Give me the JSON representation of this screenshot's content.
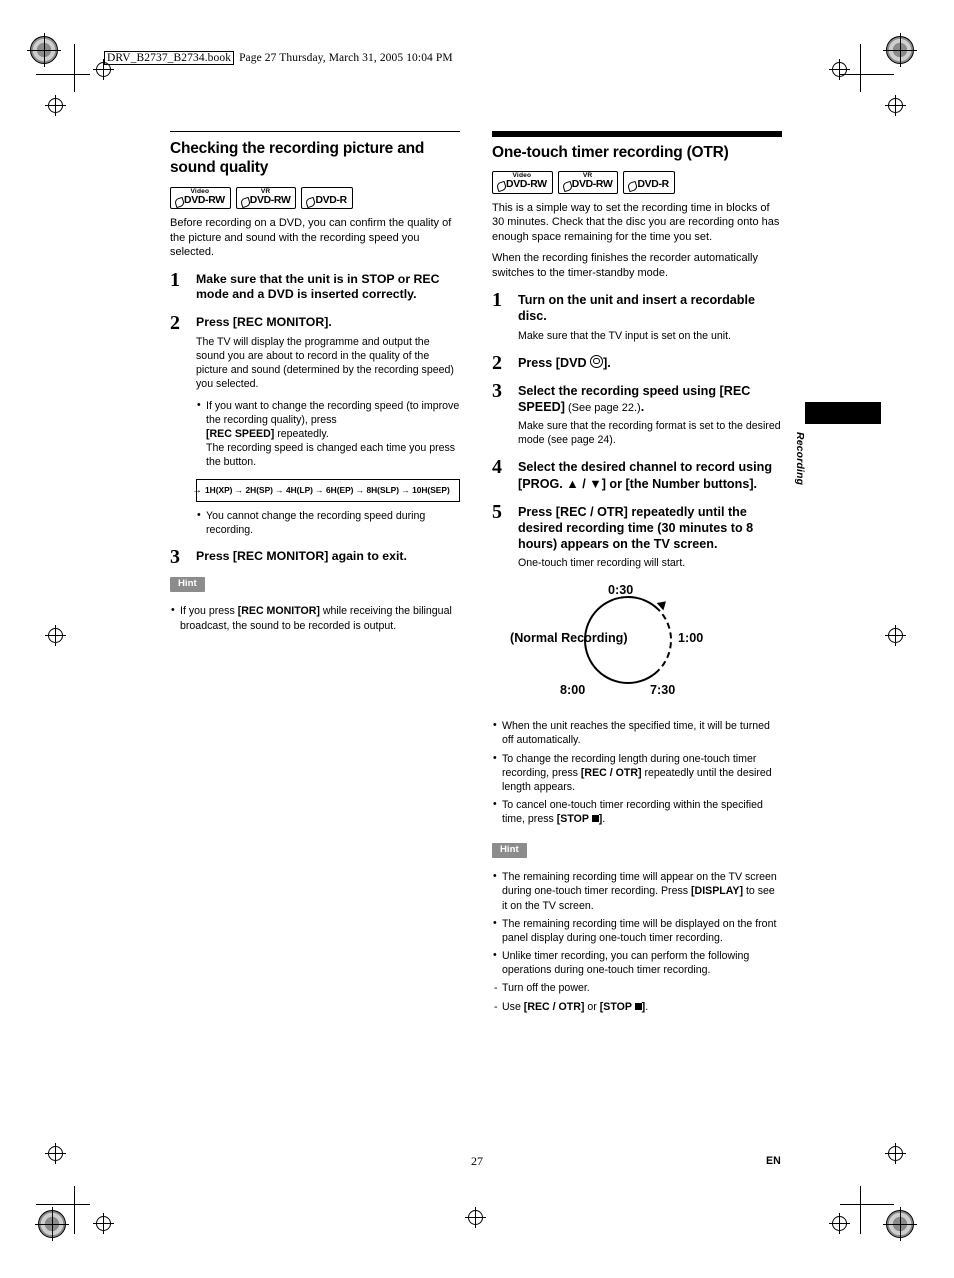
{
  "page": {
    "header_book": "DRV_B2737_B2734.book",
    "header_rest": "Page 27  Thursday, March 31, 2005  10:04 PM",
    "page_number": "27",
    "lang_mark": "EN",
    "side_tab_label": "Recording"
  },
  "left": {
    "title": "Checking the recording picture and sound quality",
    "badges": [
      {
        "top": "Video",
        "bot": "DVD-RW"
      },
      {
        "top": "VR",
        "bot": "DVD-RW"
      },
      {
        "top": "",
        "bot": "DVD-R"
      }
    ],
    "intro": "Before recording on a DVD, you can confirm the quality of the picture and sound with the recording speed you selected.",
    "steps": [
      {
        "num": "1",
        "head": "Make sure that the unit is in STOP or REC mode and a DVD is inserted correctly."
      },
      {
        "num": "2",
        "head": "Press [REC MONITOR].",
        "sub": "The TV will display the programme and output the sound you are about to record in the quality of the picture and sound (determined by the recording speed) you selected.",
        "bullets": [
          "If you want to change the recording speed (to improve the recording quality), press [REC SPEED] repeatedly.\nThe recording speed is changed each time you press the button."
        ],
        "flow": "1H(XP) → 2H(SP) → 4H(LP) → 6H(EP) → 8H(SLP) → 10H(SEP)",
        "bullets_after": [
          "You cannot change the recording speed during recording."
        ]
      },
      {
        "num": "3",
        "head": "Press [REC MONITOR] again to exit."
      }
    ],
    "hint_label": "Hint",
    "hint_items": [
      "If you press [REC MONITOR] while receiving the bilingual broadcast, the sound to be recorded is output."
    ]
  },
  "right": {
    "title": "One-touch timer recording (OTR)",
    "badges": [
      {
        "top": "Video",
        "bot": "DVD-RW"
      },
      {
        "top": "VR",
        "bot": "DVD-RW"
      },
      {
        "top": "",
        "bot": "DVD-R"
      }
    ],
    "intro_1": "This is a simple way to set the recording time in blocks of 30 minutes. Check that the disc you are recording onto has enough space remaining for the time you set.",
    "intro_2": "When the recording finishes the recorder automatically switches to the timer-standby mode.",
    "steps": [
      {
        "num": "1",
        "head": "Turn on the unit and insert a recordable disc.",
        "sub": "Make sure that the TV input is set on the unit."
      },
      {
        "num": "2",
        "head_pre": "Press [DVD ",
        "head_post": "]."
      },
      {
        "num": "3",
        "head": "Select the recording speed using [REC SPEED]",
        "head_reg": " (See page 22.)",
        "head_tail": ".",
        "sub": "Make sure that the recording format is set to the desired mode (see page 24)."
      },
      {
        "num": "4",
        "head": "Select the desired channel to record using [PROG. ▲ / ▼] or [the Number buttons]."
      },
      {
        "num": "5",
        "head": "Press [REC / OTR] repeatedly until the desired recording time (30 minutes to 8 hours) appears on the TV screen.",
        "sub": "One-touch timer recording will start."
      }
    ],
    "cycle": {
      "top": "0:30",
      "right": "1:00",
      "bottom_right": "7:30",
      "bottom_left": "8:00",
      "left": "(Normal Recording)"
    },
    "bullets": [
      "When the unit reaches the specified time, it will be turned off automatically.",
      "To change the recording length during one-touch timer recording, press [REC / OTR] repeatedly until the desired length appears.",
      "To cancel one-touch timer recording within the specified time, press [STOP ■]."
    ],
    "hint_label": "Hint",
    "hint_items": [
      "The remaining recording time will appear on the TV screen during one-touch timer recording. Press [DISPLAY] to see it on the TV screen.",
      "The remaining recording time will be displayed on the front panel display during one-touch timer recording.",
      "Unlike timer recording, you can perform the following operations during one-touch timer recording."
    ],
    "hint_dashes": [
      "Turn off the power.",
      "Use [REC / OTR] or [STOP ■]."
    ]
  },
  "colors": {
    "hint_tag_bg": "#8c8c8c",
    "rule": "#000000"
  }
}
